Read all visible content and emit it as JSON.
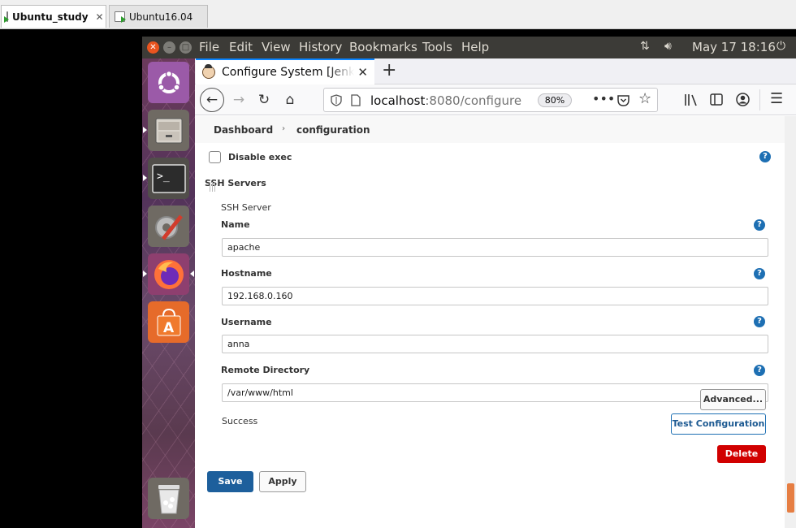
{
  "vm_tabs": [
    {
      "label": "Ubuntu_study",
      "close": "✕"
    },
    {
      "label": "Ubuntu16.04"
    }
  ],
  "top_panel": {
    "menus": [
      "File",
      "Edit",
      "View",
      "History",
      "Bookmarks",
      "Tools",
      "Help"
    ],
    "datetime": "May 17 18:16"
  },
  "launcher": {
    "items": [
      "dash-home",
      "files",
      "terminal",
      "system-settings",
      "firefox",
      "software-center",
      "trash"
    ]
  },
  "browser": {
    "tab_title": "Configure System [Jenkins]",
    "url_host": "localhost",
    "url_rest": ":8080/configure",
    "zoom": "80%"
  },
  "jenkins": {
    "breadcrumb": [
      "Dashboard",
      "configuration"
    ],
    "disable_exec_label": "Disable exec",
    "disable_exec_checked": false,
    "section_title": "SSH Servers",
    "server_title": "SSH Server",
    "name_label": "Name",
    "name_value": "apache",
    "hostname_label": "Hostname",
    "hostname_value": "192.168.0.160",
    "username_label": "Username",
    "username_value": "anna",
    "remote_dir_label": "Remote Directory",
    "remote_dir_value": "/var/www/html",
    "advanced_label": "Advanced...",
    "status_text": "Success",
    "test_label": "Test Configuration",
    "delete_label": "Delete",
    "save_label": "Save",
    "apply_label": "Apply",
    "help_glyph": "?"
  },
  "colors": {
    "jenkins_blue": "#1d5f9c",
    "delete_red": "#d10000",
    "ubuntu_orange": "#e9541f",
    "panel_bg": "#3c3b37"
  }
}
